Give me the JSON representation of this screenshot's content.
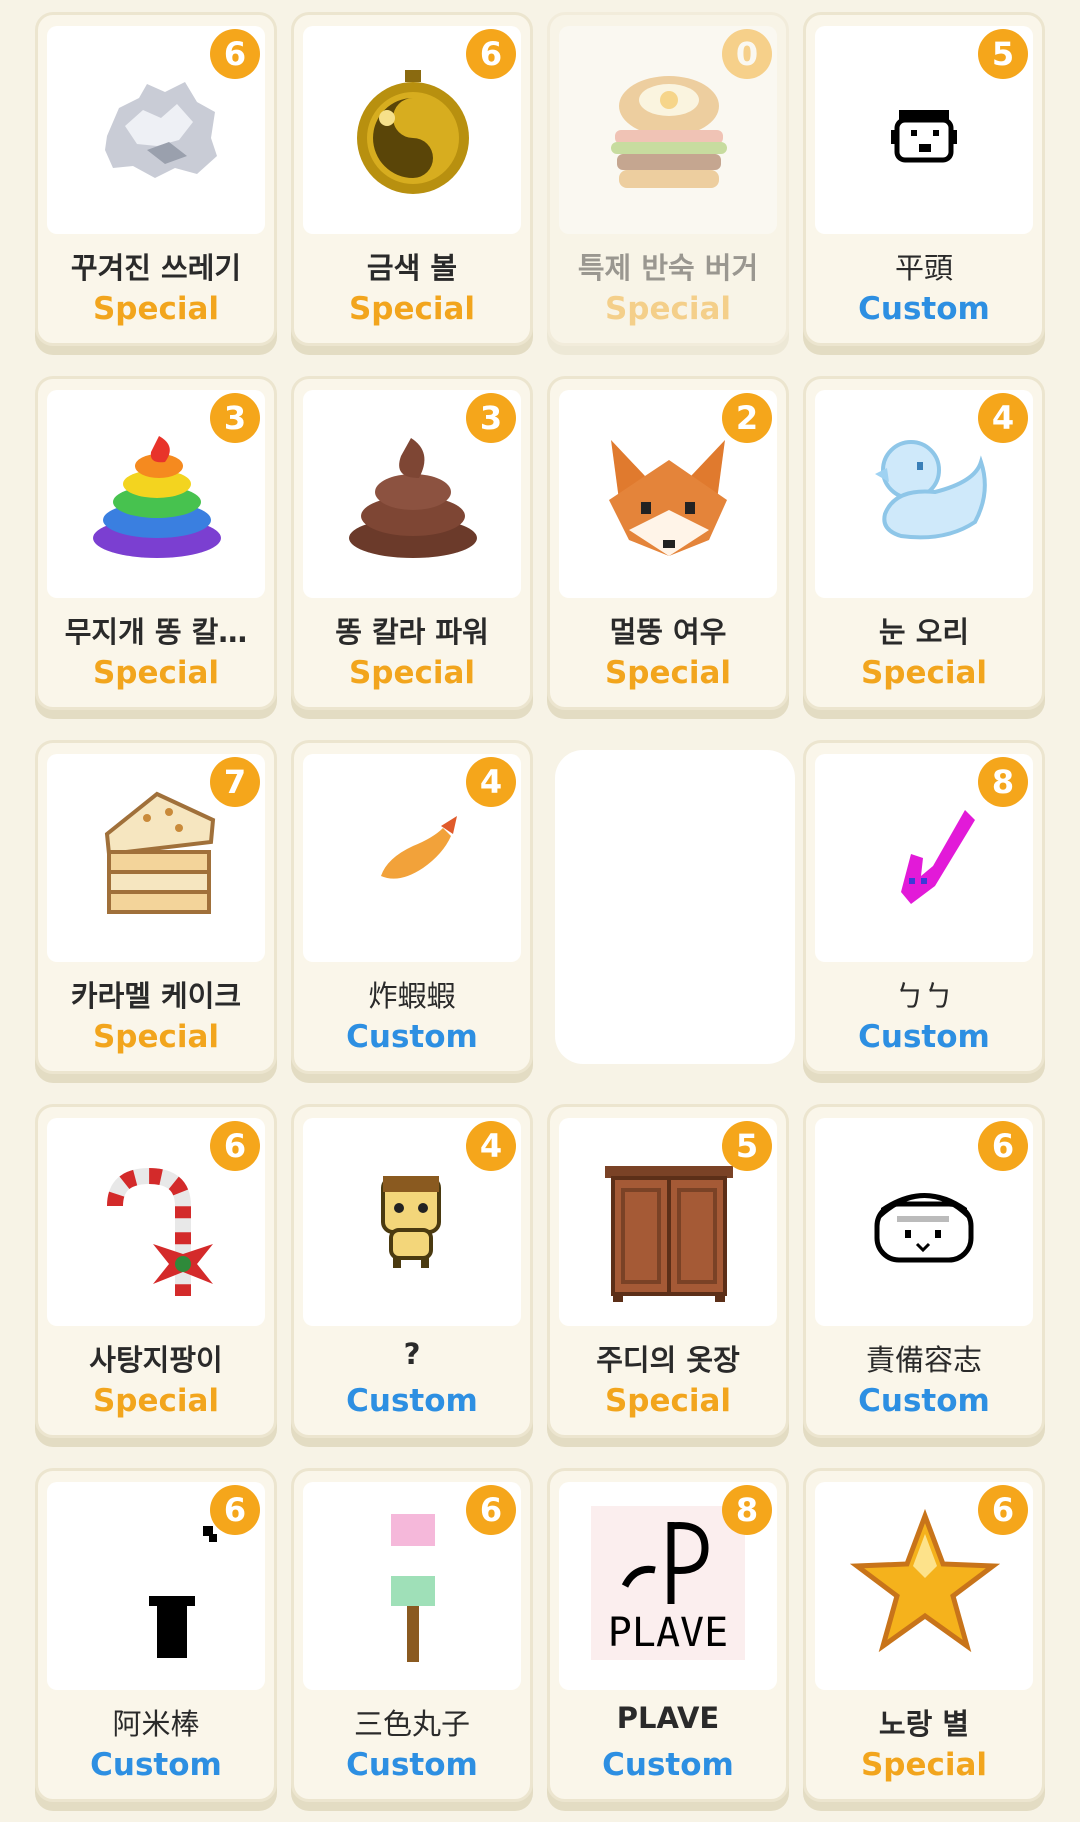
{
  "colors": {
    "badge": "#f5a61b",
    "special": "#f2a51d",
    "custom": "#2d8fe2"
  },
  "items": [
    {
      "name": "꾸겨진 쓰레기",
      "type": "Special",
      "count": "6",
      "icon": "crumpled-trash-icon"
    },
    {
      "name": "금색 볼",
      "type": "Special",
      "count": "6",
      "icon": "gold-ornament-ball-icon"
    },
    {
      "name": "특제 반숙 버거",
      "type": "Special",
      "count": "0",
      "icon": "burger-icon"
    },
    {
      "name": "平頭",
      "type": "Custom",
      "count": "5",
      "icon": "face-icon"
    },
    {
      "name": "무지개 똥 칼…",
      "type": "Special",
      "count": "3",
      "icon": "rainbow-poop-icon"
    },
    {
      "name": "똥 칼라 파워",
      "type": "Special",
      "count": "3",
      "icon": "poop-icon"
    },
    {
      "name": "멀뚱 여우",
      "type": "Special",
      "count": "2",
      "icon": "fox-icon"
    },
    {
      "name": "눈 오리",
      "type": "Special",
      "count": "4",
      "icon": "snow-duck-icon"
    },
    {
      "name": "카라멜 케이크",
      "type": "Special",
      "count": "7",
      "icon": "caramel-cake-icon"
    },
    {
      "name": "炸蝦蝦",
      "type": "Custom",
      "count": "4",
      "icon": "fried-shrimp-icon"
    },
    {
      "name": "ㄅㄅ",
      "type": "Custom",
      "count": "8",
      "icon": "magenta-shape-icon"
    },
    {
      "name": "사탕지팡이",
      "type": "Special",
      "count": "6",
      "icon": "candy-cane-icon"
    },
    {
      "name": "?",
      "type": "Custom",
      "count": "4",
      "icon": "character-icon"
    },
    {
      "name": "주디의 옷장",
      "type": "Special",
      "count": "5",
      "icon": "wardrobe-icon"
    },
    {
      "name": "責備容志",
      "type": "Custom",
      "count": "6",
      "icon": "face-icon"
    },
    {
      "name": "阿米棒",
      "type": "Custom",
      "count": "6",
      "icon": "stick-icon"
    },
    {
      "name": "三色丸子",
      "type": "Custom",
      "count": "6",
      "icon": "dango-icon"
    },
    {
      "name": "PLAVE",
      "type": "Custom",
      "count": "8",
      "icon": "plave-logo-icon",
      "logo_text": "PLAVE"
    },
    {
      "name": "노랑 별",
      "type": "Special",
      "count": "6",
      "icon": "yellow-star-icon"
    }
  ]
}
